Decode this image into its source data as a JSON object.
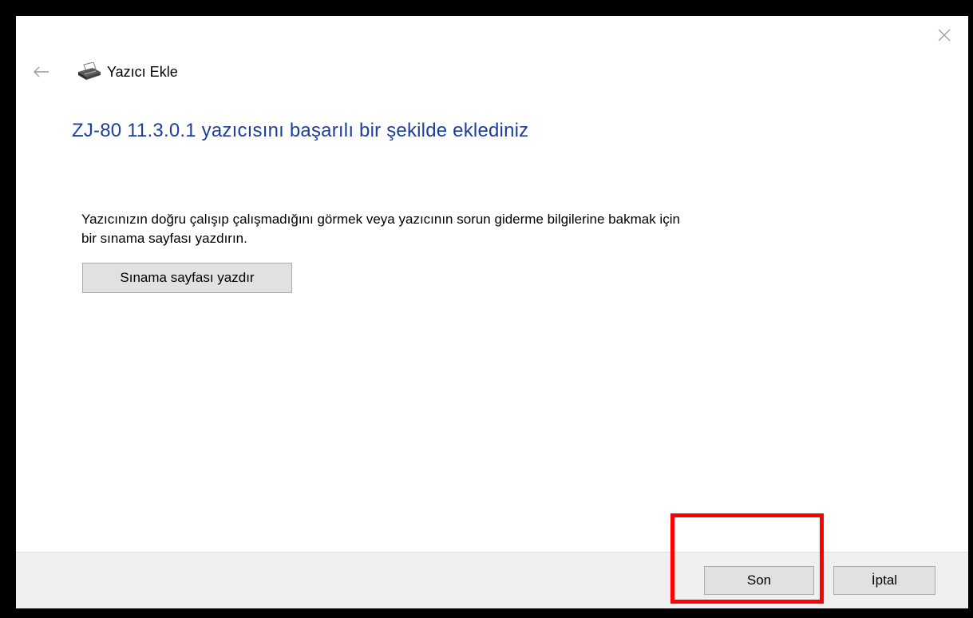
{
  "window": {
    "title": "Yazıcı Ekle",
    "back_icon": "back-arrow-icon",
    "printer_icon": "printer-icon",
    "close_icon": "close-icon"
  },
  "main": {
    "heading": "ZJ-80 11.3.0.1 yazıcısını başarılı bir şekilde eklediniz",
    "description_line1": "Yazıcınızın doğru çalışıp çalışmadığını görmek veya yazıcının sorun giderme bilgilerine bakmak için",
    "description_line2": "bir sınama sayfası yazdırın.",
    "test_page_button": "Sınama sayfası yazdır"
  },
  "footer": {
    "finish_button": "Son",
    "cancel_button": "İptal"
  },
  "colors": {
    "heading": "#1e3f9c",
    "highlight": "#ff0000",
    "footer_bg": "#f0f0f0",
    "button_bg": "#e1e1e1"
  }
}
